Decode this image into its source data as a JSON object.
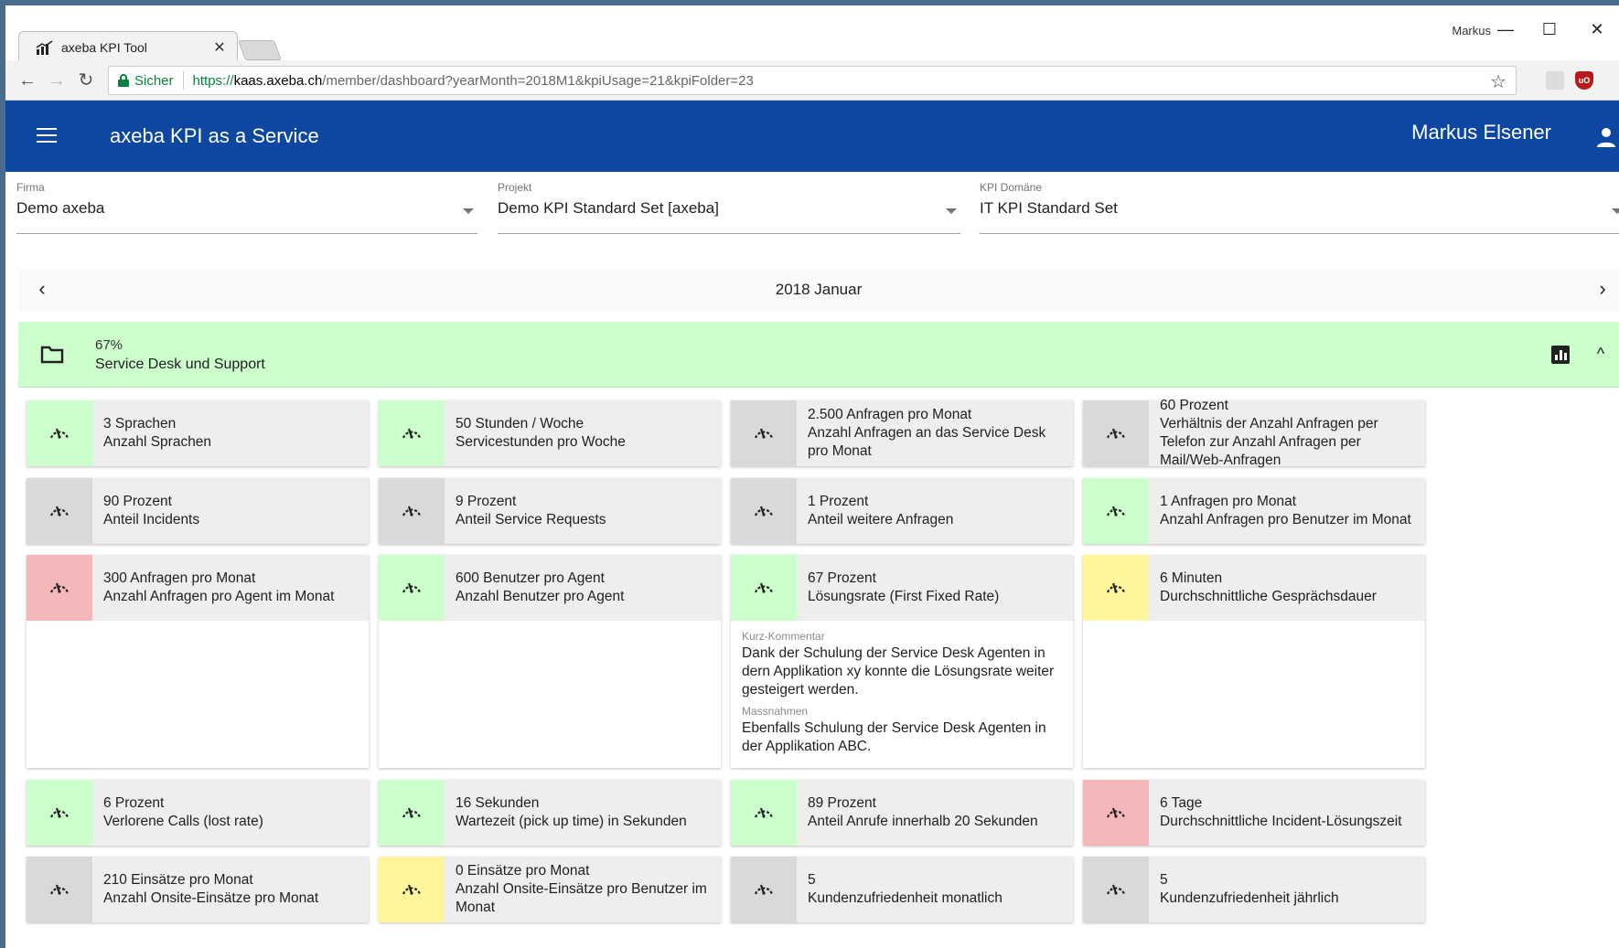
{
  "browser": {
    "tab_title": "axeba KPI Tool",
    "profile_name": "Markus",
    "secure_label": "Sicher",
    "url_scheme": "https://",
    "url_host": "kaas.axeba.ch",
    "url_path": "/member/dashboard?yearMonth=2018M1&kpiUsage=21&kpiFolder=23",
    "icons": [
      "back-icon",
      "forward-icon",
      "reload-icon",
      "lock-icon",
      "star-icon",
      "pdf-extension-icon",
      "ublock-icon",
      "menu-icon"
    ]
  },
  "appbar": {
    "title": "axeba KPI as a Service",
    "user_name": "Markus Elsener",
    "color": "#0d47a1"
  },
  "filters": {
    "firma": {
      "label": "Firma",
      "value": "Demo axeba"
    },
    "projekt": {
      "label": "Projekt",
      "value": "Demo KPI Standard Set [axeba]"
    },
    "domaene": {
      "label": "KPI Domäne",
      "value": "IT KPI Standard Set"
    }
  },
  "month": {
    "label": "2018 Januar"
  },
  "folder": {
    "percent": "67%",
    "name": "Service Desk und Support"
  },
  "status_colors": {
    "green": "#ccffcc",
    "gray": "#d9d9d9",
    "red": "#f4b8ba",
    "yellow": "#fff59d"
  },
  "kpis": [
    {
      "value": "3 Sprachen",
      "name": "Anzahl Sprachen",
      "status": "green"
    },
    {
      "value": "50 Stunden / Woche",
      "name": "Servicestunden pro Woche",
      "status": "green"
    },
    {
      "value": "2.500 Anfragen pro Monat",
      "name": "Anzahl Anfragen an das Service Desk pro Monat",
      "status": "gray"
    },
    {
      "value": "60 Prozent",
      "name": "Verhältnis der Anzahl Anfragen per Telefon zur Anzahl Anfragen per Mail/Web-Anfragen",
      "status": "gray"
    },
    {
      "value": "90 Prozent",
      "name": "Anteil Incidents",
      "status": "gray"
    },
    {
      "value": "9 Prozent",
      "name": "Anteil Service Requests",
      "status": "gray"
    },
    {
      "value": "1 Prozent",
      "name": "Anteil weitere Anfragen",
      "status": "gray"
    },
    {
      "value": "1 Anfragen pro Monat",
      "name": "Anzahl Anfragen pro Benutzer im Monat",
      "status": "green"
    },
    {
      "value": "300 Anfragen pro Monat",
      "name": "Anzahl Anfragen pro Agent im Monat",
      "status": "red"
    },
    {
      "value": "600 Benutzer pro Agent",
      "name": "Anzahl Benutzer pro Agent",
      "status": "green"
    },
    {
      "value": "67 Prozent",
      "name": "Lösungsrate (First Fixed Rate)",
      "status": "green",
      "comment_label": "Kurz-Kommentar",
      "comment": "Dank der Schulung der Service Desk Agenten in dern Applikation xy konnte die Lösungsrate weiter gesteigert werden.",
      "measures_label": "Massnahmen",
      "measures": "Ebenfalls Schulung der Service Desk Agenten in der Applikation ABC."
    },
    {
      "value": "6 Minuten",
      "name": "Durchschnittliche Gesprächsdauer",
      "status": "yellow"
    },
    {
      "value": "6 Prozent",
      "name": "Verlorene Calls (lost rate)",
      "status": "green"
    },
    {
      "value": "16 Sekunden",
      "name": "Wartezeit (pick up time) in Sekunden",
      "status": "green"
    },
    {
      "value": "89 Prozent",
      "name": "Anteil Anrufe innerhalb 20 Sekunden",
      "status": "green"
    },
    {
      "value": "6 Tage",
      "name": "Durchschnittliche Incident-Lösungszeit",
      "status": "red"
    },
    {
      "value": "210 Einsätze pro Monat",
      "name": "Anzahl Onsite-Einsätze pro Monat",
      "status": "gray"
    },
    {
      "value": "0 Einsätze pro Monat",
      "name": "Anzahl Onsite-Einsätze pro Benutzer im Monat",
      "status": "yellow"
    },
    {
      "value": "5",
      "name": "Kundenzufriedenheit monatlich",
      "status": "gray"
    },
    {
      "value": "5",
      "name": "Kundenzufriedenheit jährlich",
      "status": "gray"
    }
  ]
}
